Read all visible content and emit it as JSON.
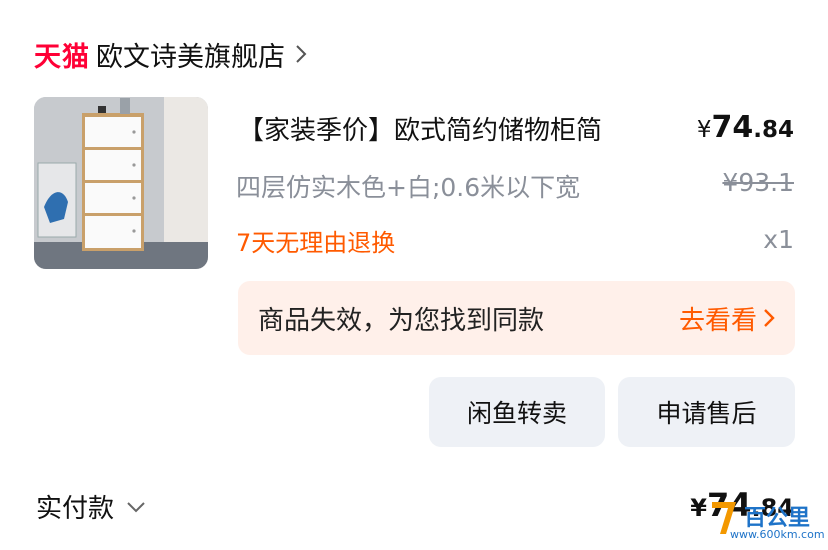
{
  "shop": {
    "platform": "天猫",
    "name": "欧文诗美旗舰店"
  },
  "product": {
    "title": "【家装季价】欧式简约储物柜简",
    "price_currency": "¥",
    "price_int": "74",
    "price_dec": ".84",
    "spec": "四层仿实木色+白;0.6米以下宽",
    "original_price": "¥93.1",
    "return_policy": "7天无理由退换",
    "quantity": "x1",
    "image_icon": "storage-cabinet-photo"
  },
  "invalid_notice": {
    "text": "商品失效，为您找到同款",
    "link_label": "去看看"
  },
  "actions": {
    "xianyu_label": "闲鱼转卖",
    "after_sale_label": "申请售后"
  },
  "payment": {
    "label": "实付款",
    "currency": "¥",
    "amount_int": "74",
    "amount_dec": ".84"
  },
  "watermark": {
    "brand": "百公里",
    "url": "www.600km.com"
  },
  "colors": {
    "tmall_red": "#ff0036",
    "accent_orange": "#ff5a00",
    "muted_gray": "#8a8f99",
    "banner_bg": "#fff0ea",
    "button_bg": "#eef1f6"
  }
}
